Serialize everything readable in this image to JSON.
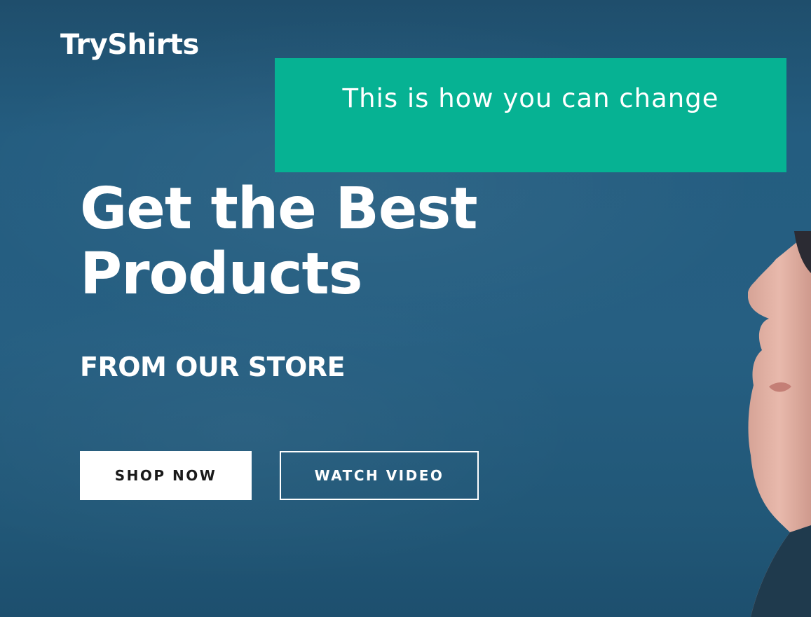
{
  "header": {
    "logo_text": "TryShirts"
  },
  "notice": {
    "text": "This is how you can change"
  },
  "hero": {
    "headline_line1": "Get the Best",
    "headline_line2": "Products",
    "subheading": "FROM OUR STORE",
    "primary_button_label": "SHOP NOW",
    "secondary_button_label": "WATCH VIDEO"
  },
  "colors": {
    "background": "#225b7c",
    "notice_background": "#06b293",
    "text": "#ffffff"
  }
}
